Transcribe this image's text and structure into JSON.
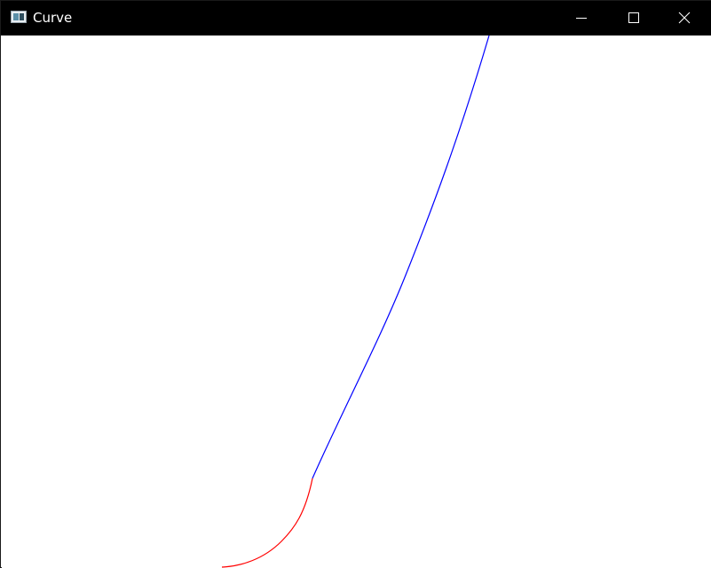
{
  "window": {
    "title": "Curve",
    "icon": "app-window-icon",
    "controls": {
      "minimize_icon": "minimize-icon",
      "maximize_icon": "maximize-icon",
      "close_icon": "close-icon"
    }
  },
  "canvas": {
    "background": "#ffffff",
    "segments": [
      {
        "name": "red",
        "color": "#ff0000"
      },
      {
        "name": "blue",
        "color": "#0000ff"
      }
    ]
  }
}
